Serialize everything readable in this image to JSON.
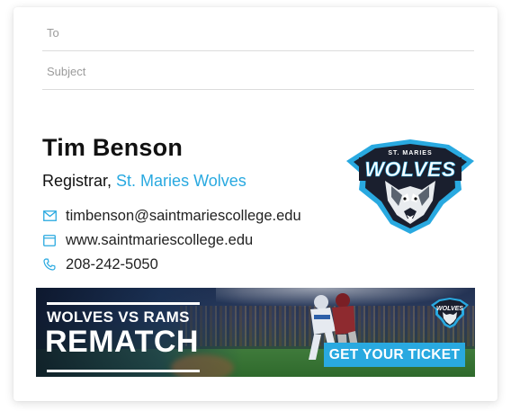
{
  "compose": {
    "to_placeholder": "To",
    "subject_placeholder": "Subject"
  },
  "signature": {
    "name": "Tim Benson",
    "role": "Registrar,",
    "organization": "St. Maries Wolves",
    "email": "timbenson@saintmariescollege.edu",
    "website": "www.saintmariescollege.edu",
    "phone": "208-242-5050",
    "logo": {
      "top_text": "ST. MARIES",
      "main_text": "WOLVES"
    }
  },
  "banner": {
    "line1": "WOLVES VS RAMS",
    "line2": "REMATCH",
    "button_label": "GET YOUR TICKET",
    "mini_logo_text": "WOLVES"
  },
  "colors": {
    "accent": "#29a9e0",
    "text": "#111111",
    "placeholder": "#9b9b9b"
  },
  "icons": {
    "email": "envelope-icon",
    "website": "browser-window-icon",
    "phone": "phone-icon"
  }
}
